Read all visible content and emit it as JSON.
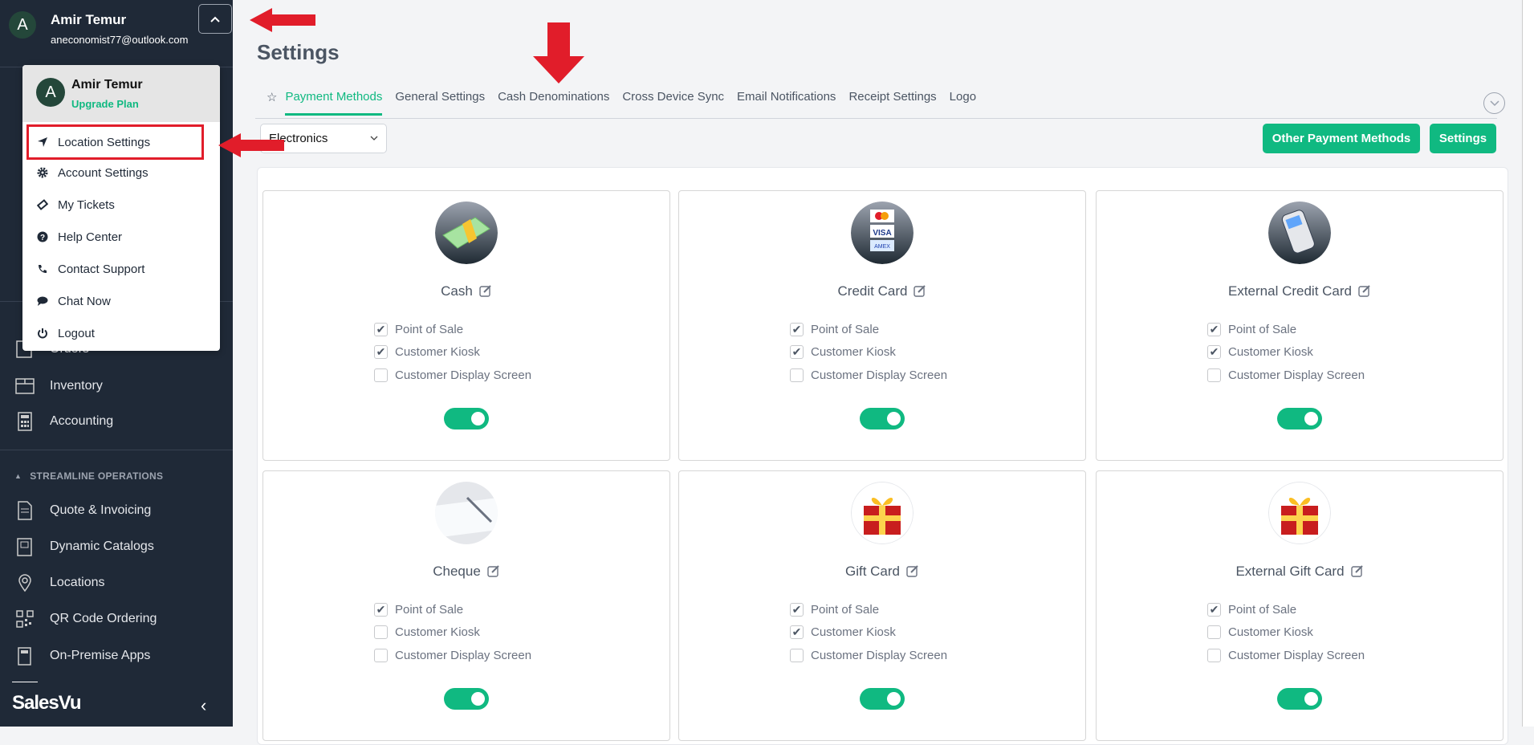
{
  "user": {
    "initial": "A",
    "name": "Amir Temur",
    "email": "aneconomist77@outlook.com"
  },
  "dropdown": {
    "name": "Amir Temur",
    "upgrade": "Upgrade Plan",
    "items": [
      {
        "label": "Location Settings",
        "icon": "location-arrow-icon"
      },
      {
        "label": "Account Settings",
        "icon": "gear-icon"
      },
      {
        "label": "My Tickets",
        "icon": "ticket-icon"
      },
      {
        "label": "Help Center",
        "icon": "question-circle-icon"
      },
      {
        "label": "Contact Support",
        "icon": "phone-icon"
      },
      {
        "label": "Chat Now",
        "icon": "chat-icon"
      },
      {
        "label": "Logout",
        "icon": "power-icon"
      }
    ]
  },
  "sidebar": {
    "items": [
      {
        "label": "Orders"
      },
      {
        "label": "Inventory"
      },
      {
        "label": "Accounting"
      }
    ],
    "section": "STREAMLINE OPERATIONS",
    "section_items": [
      {
        "label": "Quote & Invoicing"
      },
      {
        "label": "Dynamic Catalogs"
      },
      {
        "label": "Locations"
      },
      {
        "label": "QR Code Ordering"
      },
      {
        "label": "On-Premise Apps"
      }
    ],
    "brand": "SalesVu"
  },
  "page": {
    "title": "Settings",
    "tabs": [
      {
        "label": "Payment Methods",
        "active": true
      },
      {
        "label": "General Settings"
      },
      {
        "label": "Cash Denominations"
      },
      {
        "label": "Cross Device Sync"
      },
      {
        "label": "Email Notifications"
      },
      {
        "label": "Receipt Settings"
      },
      {
        "label": "Logo"
      }
    ],
    "location_select": "Electronics",
    "other_methods_btn": "Other Payment Methods",
    "settings_btn": "Settings"
  },
  "option_labels": [
    "Point of Sale",
    "Customer Kiosk",
    "Customer Display Screen"
  ],
  "cards": [
    {
      "name": "Cash",
      "icon": "cash-icon",
      "options": [
        true,
        true,
        false
      ],
      "enabled": true
    },
    {
      "name": "Credit Card",
      "icon": "credit-card-icon",
      "options": [
        true,
        true,
        false
      ],
      "enabled": true
    },
    {
      "name": "External Credit Card",
      "icon": "card-terminal-icon",
      "options": [
        true,
        true,
        false
      ],
      "enabled": true
    },
    {
      "name": "Cheque",
      "icon": "cheque-icon",
      "options": [
        true,
        false,
        false
      ],
      "enabled": true
    },
    {
      "name": "Gift Card",
      "icon": "gift-icon",
      "options": [
        true,
        true,
        false
      ],
      "enabled": true
    },
    {
      "name": "External Gift Card",
      "icon": "gift-icon",
      "options": [
        true,
        false,
        false
      ],
      "enabled": true
    }
  ],
  "colors": {
    "accent": "#10b981",
    "sidebar": "#1f2937",
    "annotation": "#e11d2a"
  }
}
